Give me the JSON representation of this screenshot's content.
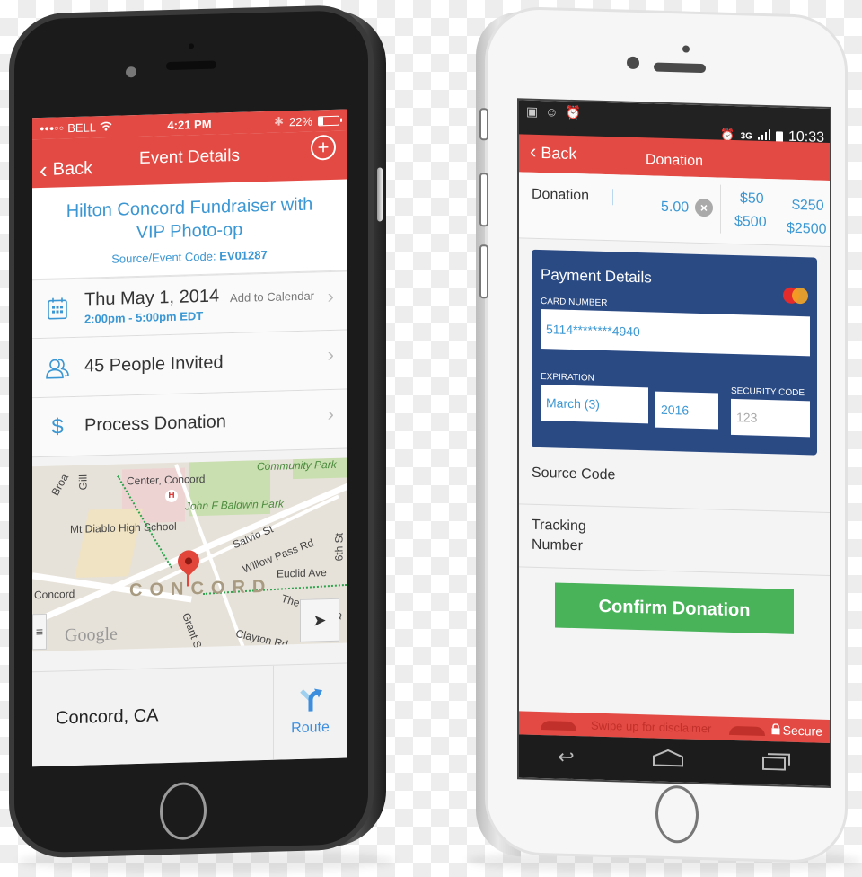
{
  "left_phone": {
    "status_bar": {
      "carrier": "BELL",
      "signal_dots": "●●●○○",
      "time": "4:21 PM",
      "battery_percent": "22%",
      "battery_level": 0.22
    },
    "nav": {
      "back_label": "Back",
      "title": "Event Details",
      "add_icon": "plus-circle-icon"
    },
    "event": {
      "title": "Hilton Concord Fundraiser with VIP Photo-op",
      "code_label": "Source/Event Code:",
      "code_value": "EV01287"
    },
    "rows": [
      {
        "icon": "calendar-icon",
        "label": "Thu May 1, 2014",
        "sub": "2:00pm - 5:00pm EDT",
        "extra": "Add to Calendar"
      },
      {
        "icon": "people-icon",
        "label": "45 People Invited"
      },
      {
        "icon": "dollar-icon",
        "label": "Process Donation"
      }
    ],
    "map": {
      "labels": {
        "community_park": "Community Park",
        "center_concord": "Center, Concord",
        "baldwin_park": "John F Baldwin Park",
        "school": "Mt Diablo High School",
        "salvio": "Salvio St",
        "willow_pass": "Willow Pass Rd",
        "euclid": "Euclid Ave",
        "sixth": "6th St",
        "concord_small": "Concord",
        "concord_big": "CONCORD",
        "the_alameda": "The Alameda",
        "grant": "Grant St",
        "clayton": "Clayton Rd",
        "broadway": "Broa",
        "gill": "Gill",
        "google": "Google"
      }
    },
    "location": {
      "city": "Concord, CA",
      "route_label": "Route"
    }
  },
  "right_phone": {
    "status_bar": {
      "network": "3G",
      "time": "10:33"
    },
    "nav": {
      "back_label": "Back",
      "title": "Donation"
    },
    "donation": {
      "label": "Donation",
      "amount": "5.00",
      "quick_amounts": [
        "$50",
        "$250",
        "$500",
        "$2500"
      ]
    },
    "payment": {
      "title": "Payment Details",
      "card_number_label": "CARD NUMBER",
      "card_number": "5114********4940",
      "expiration_label": "EXPIRATION",
      "exp_month": "March (3)",
      "exp_year": "2016",
      "security_label": "SECURITY CODE",
      "security_placeholder": "123",
      "card_brand": "MasterCard"
    },
    "fields": {
      "source_code": "Source Code",
      "tracking_line1": "Tracking",
      "tracking_line2": "Number"
    },
    "confirm_label": "Confirm Donation",
    "footer": {
      "swipe_text": "Swipe up for disclaimer",
      "secure_label": "Secure"
    }
  },
  "colors": {
    "brand_red": "#e34a43",
    "link_blue": "#3b97d3",
    "card_blue": "#2a4a84",
    "confirm_green": "#49b35a"
  }
}
